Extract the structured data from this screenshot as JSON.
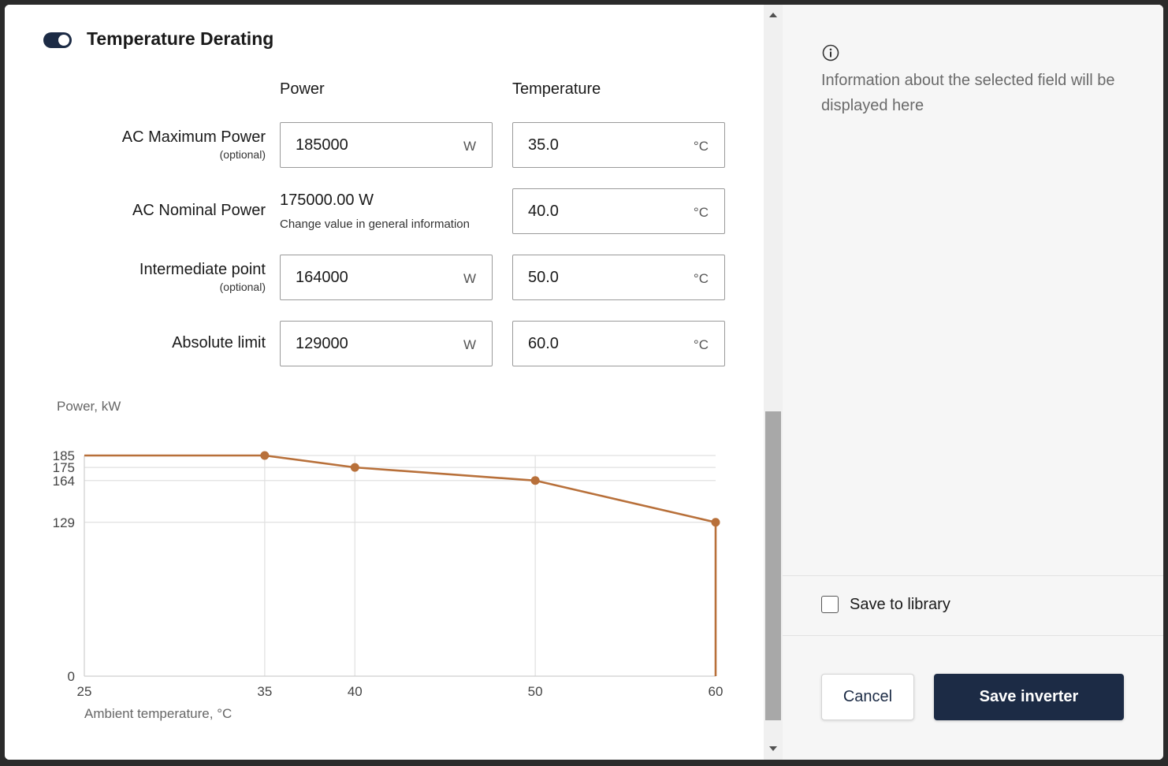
{
  "section": {
    "title": "Temperature Derating",
    "toggle_on": true
  },
  "columns": {
    "power": "Power",
    "temperature": "Temperature"
  },
  "rows": [
    {
      "label": "AC Maximum Power",
      "sub": "(optional)",
      "power": "185000",
      "power_unit": "W",
      "temp": "35.0",
      "temp_unit": "°C"
    },
    {
      "label": "AC Nominal Power",
      "sub": "",
      "power_static": "175000.00 W",
      "power_hint": "Change value in general information",
      "temp": "40.0",
      "temp_unit": "°C"
    },
    {
      "label": "Intermediate point",
      "sub": "(optional)",
      "power": "164000",
      "power_unit": "W",
      "temp": "50.0",
      "temp_unit": "°C"
    },
    {
      "label": "Absolute limit",
      "sub": "",
      "power": "129000",
      "power_unit": "W",
      "temp": "60.0",
      "temp_unit": "°C"
    }
  ],
  "chart_data": {
    "type": "line",
    "title": "",
    "ylabel": "Power, kW",
    "xlabel": "Ambient temperature, °C",
    "xlim": [
      25,
      60
    ],
    "ylim": [
      0,
      185
    ],
    "x_ticks": [
      25,
      35,
      40,
      50,
      60
    ],
    "y_ticks": [
      0,
      129,
      164,
      175,
      185
    ],
    "series": [
      {
        "x": [
          25,
          35,
          40,
          50,
          60,
          60
        ],
        "y": [
          185,
          185,
          175,
          164,
          129,
          0
        ],
        "color": "#b8703a"
      }
    ],
    "markers": [
      {
        "x": 35,
        "y": 185
      },
      {
        "x": 40,
        "y": 175
      },
      {
        "x": 50,
        "y": 164
      },
      {
        "x": 60,
        "y": 129
      }
    ],
    "grid": true
  },
  "info": {
    "text": "Information about the selected field will be displayed here"
  },
  "save_library": {
    "label": "Save to library",
    "checked": false
  },
  "buttons": {
    "cancel": "Cancel",
    "save": "Save inverter"
  },
  "colors": {
    "accent": "#1c2b45",
    "series": "#b8703a",
    "grid": "#e0e0e0"
  }
}
